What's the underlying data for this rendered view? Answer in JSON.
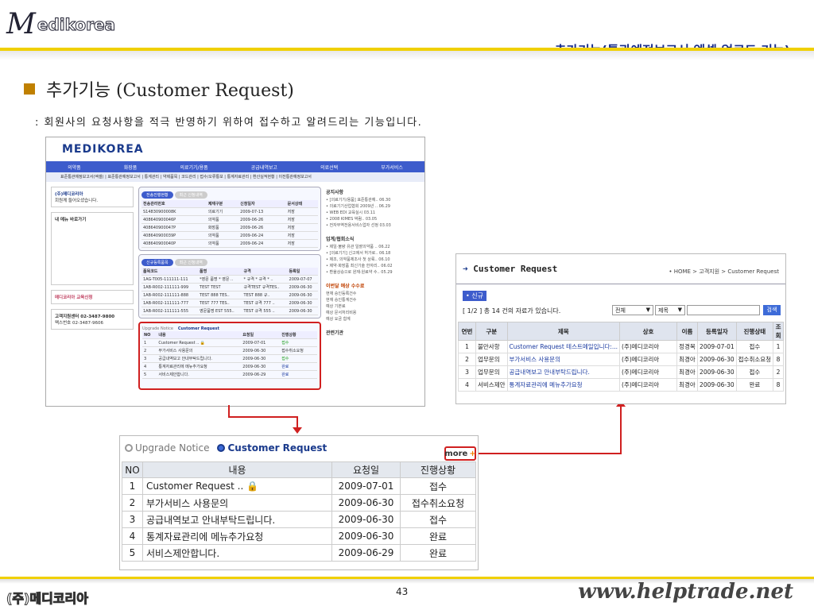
{
  "header": {
    "logo_m": "M",
    "logo_text": "edikorea",
    "subtitle": "- 추가기능(통관예정보고서 엑셀 업로드 기능)"
  },
  "heading": {
    "title": "추가기능 (Customer Request)",
    "description": ": 회원사의 요청사항을 적극 반영하기 위하여 접수하고 알려드리는 기능입니다."
  },
  "left_shot": {
    "logo": "MEDIKOREA",
    "nav": [
      "의약품",
      "화장품",
      "의료기기/용품",
      "공급내역보고",
      "의료선택",
      "부가서비스"
    ],
    "subnav": "표준통관예정보고서(엑셀) | 표준통관예정보고서 | 통계관리 | 약제품목 | 코드관리 | 접수/오류통보 | 통계자료관리 | 환산실적현황 | 이전통관예정보고서",
    "side": {
      "company": "(주)메디코리아",
      "greet": "회원께 들어오셨습니다.",
      "favorites": "내 메뉴 바로가기",
      "edu": "메디코리아 교육신청",
      "center": "고객지원센터 02-3487-9800",
      "fax": "팩스번호 02-3487-9606"
    },
    "tab1": {
      "on": "전송진행현황",
      "off": "최근 신청내역"
    },
    "t1_head": [
      "전송관리번호",
      "제재구분",
      "신청일자",
      "문서상태"
    ],
    "t1_rows": [
      [
        "S14830900008K",
        "의료기기",
        "2009-07-13",
        "저장"
      ],
      [
        "408640900046P",
        "의약품",
        "2009-06-26",
        "저장"
      ],
      [
        "408640900047P",
        "화장품",
        "2009-06-26",
        "저장"
      ],
      [
        "408640900039P",
        "의약품",
        "2009-06-24",
        "저장"
      ],
      [
        "408640900040P",
        "의약품",
        "2009-06-24",
        "저장"
      ]
    ],
    "tab2": {
      "on": "신규등록품목",
      "off": "최근 신청내역"
    },
    "t2_head": [
      "품목코드",
      "품명",
      "규격",
      "등록일"
    ],
    "t2_rows": [
      [
        "1AG-T005-111111-111",
        "*영문 품명 * 영문 ..",
        "* 규격 * 규격 * ..",
        "2009-07-07"
      ],
      [
        "1AB-R002-111111-999",
        "TEST TEST",
        "규격TEST 규격TES..",
        "2009-06-30"
      ],
      [
        "1AB-R002-111111-888",
        "TEST 888 TES..",
        "TEST 888 규..",
        "2009-06-30"
      ],
      [
        "1AB-R002-111111-777",
        "TEST 777 TES..",
        "TEST 규격 777 ..",
        "2009-06-30"
      ],
      [
        "1AB-R002-111111-555",
        "영문품명 EST 555..",
        "TEST 규격 555 ..",
        "2009-06-30"
      ]
    ],
    "notice_title": "공지사항",
    "notices": [
      "[의료기기/용품] 표준통관예..",
      "의료기기산업협회 2009년 ..",
      "WEB EDI 교육실시",
      "2008 KIMES 박람..",
      "전자무역전용서비스업자 선정"
    ],
    "notice_dates": [
      "06.30",
      "06.29",
      "03.11",
      "03.05",
      "03.03"
    ],
    "forum_title": "업계/협회소식",
    "forum": [
      "제일·불량 유관 일괄의약품 ..",
      "[의료기기] 신고에서 허가로..",
      "제조, 의약품제조사 첫 상륙..",
      "제약·화장품 최신기술 한자리..",
      "환율상승으로 원재·원료약 수.."
    ],
    "forum_dates": [
      "06.22",
      "06.18",
      "06.10",
      "06.02",
      "05.29"
    ],
    "month_title": "이번달 예상 수수료",
    "month_rows": [
      "현재 승인등록건수",
      "현재 승인통계건수",
      "예상 기본료",
      "예상 문서처리비용",
      "예상 요금 합계"
    ],
    "related": "관련기관"
  },
  "zoom": {
    "tab_off": "Upgrade Notice",
    "tab_on": "Customer Request",
    "more": "more",
    "columns": [
      "NO",
      "내용",
      "요청일",
      "진행상황"
    ],
    "rows": [
      {
        "no": "1",
        "content": "Customer Request .. 🔒",
        "date": "2009-07-01",
        "status": "접수"
      },
      {
        "no": "2",
        "content": "부가서비스 사용문의",
        "date": "2009-06-30",
        "status": "접수취소요청"
      },
      {
        "no": "3",
        "content": "공급내역보고 안내부탁드립니다.",
        "date": "2009-06-30",
        "status": "접수"
      },
      {
        "no": "4",
        "content": "통계자료관리에 메뉴추가요청",
        "date": "2009-06-30",
        "status": "완료"
      },
      {
        "no": "5",
        "content": "서비스제안합니다.",
        "date": "2009-06-29",
        "status": "완료"
      }
    ]
  },
  "right_shot": {
    "title": "Customer Request",
    "breadcrumb": "• HOME > 고객지원 > Customer Request",
    "new_btn": "• 신규",
    "count": "[ 1/2 ]   총 14 건의 자료가 있습니다.",
    "select1": "전체",
    "select2": "제목",
    "search_btn": "검색",
    "columns": [
      "연번",
      "구분",
      "제목",
      "상호",
      "이름",
      "등록일자",
      "진행상태",
      "조회"
    ],
    "rows": [
      [
        "1",
        "불만사항",
        "Customer Request 테스트메일입니다:...",
        "(주)메디코리아",
        "정경목",
        "2009-07-01",
        "접수",
        "1"
      ],
      [
        "2",
        "업무문의",
        "부가서비스 사용문의",
        "(주)메디코리아",
        "최경아",
        "2009-06-30",
        "접수취소요청",
        "8"
      ],
      [
        "3",
        "업무문의",
        "공급내역보고 안내부탁드립니다.",
        "(주)메디코리아",
        "최경아",
        "2009-06-30",
        "접수",
        "2"
      ],
      [
        "4",
        "서비스제안",
        "통계자료관리에 메뉴추가요청",
        "(주)메디코리아",
        "최경아",
        "2009-06-30",
        "완료",
        "8"
      ]
    ]
  },
  "footer": {
    "left": "(주)메디코리아",
    "page": "43",
    "url": "www.helptrade.net"
  }
}
